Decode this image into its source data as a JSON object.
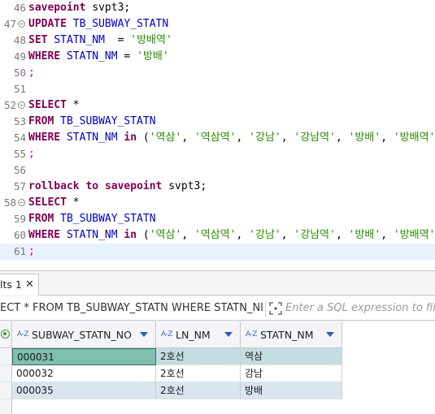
{
  "editor": {
    "lines": [
      {
        "num": "46",
        "text": "savepoint svpt3;"
      },
      {
        "num": "47",
        "text": "UPDATE TB_SUBWAY_STATN"
      },
      {
        "num": "48",
        "text": "SET STATN_NM  = '방배역'"
      },
      {
        "num": "49",
        "text": "WHERE STATN_NM = '방배'"
      },
      {
        "num": "50",
        "text": ";"
      },
      {
        "num": "51",
        "text": ""
      },
      {
        "num": "52",
        "text": "SELECT *"
      },
      {
        "num": "53",
        "text": "FROM TB_SUBWAY_STATN"
      },
      {
        "num": "54",
        "text": "WHERE STATN_NM in ('역삼', '역삼역', '강남', '강남역', '방배', '방배역')"
      },
      {
        "num": "55",
        "text": ";"
      },
      {
        "num": "56",
        "text": ""
      },
      {
        "num": "57",
        "text": "rollback to savepoint svpt3;"
      },
      {
        "num": "58",
        "text": "SELECT *"
      },
      {
        "num": "59",
        "text": "FROM TB_SUBWAY_STATN"
      },
      {
        "num": "60",
        "text": "WHERE STATN_NM in ('역삼', '역삼역', '강남', '강남역', '방배', '방배역')"
      },
      {
        "num": "61",
        "text": ";"
      }
    ],
    "current_line": "61"
  },
  "results": {
    "tab_label": "lts 1",
    "tab_close": "✕",
    "query_text": "ECT * FROM TB_SUBWAY_STATN WHERE STATN_NI",
    "filter_placeholder": "Enter a SQL expression to filter",
    "columns": [
      "SUBWAY_STATN_NO",
      "LN_NM",
      "STATN_NM"
    ],
    "column_type_icon": "A-Z",
    "rows": [
      [
        "000031",
        "2호선",
        "역삼"
      ],
      [
        "000032",
        "2호선",
        "강남"
      ],
      [
        "000035",
        "2호선",
        "방배"
      ]
    ]
  },
  "colors": {
    "keyword": "#7f0055",
    "identifier": "#0000c0",
    "string": "#2a8c00",
    "selected_cell": "#7fbfb0",
    "current_line": "#e8f2fe"
  }
}
